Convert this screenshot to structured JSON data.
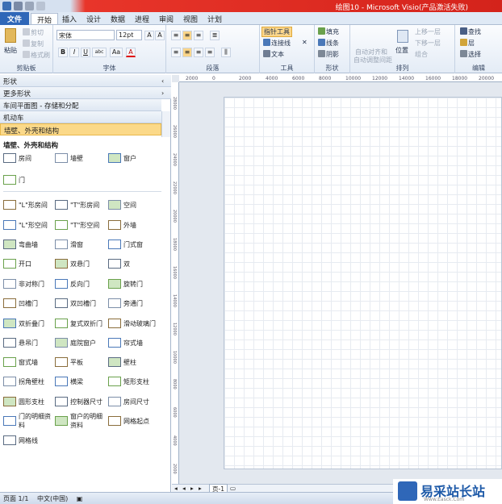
{
  "window": {
    "title": "绘图10 - Microsoft Visio(产品激活失败)"
  },
  "tabs": [
    "文件",
    "开始",
    "插入",
    "设计",
    "数据",
    "进程",
    "审阅",
    "视图",
    "计划"
  ],
  "ribbon": {
    "clipboard": {
      "label": "剪贴板",
      "paste": "粘贴",
      "cut": "剪切",
      "copy": "复制",
      "format_painter": "格式刷"
    },
    "font": {
      "label": "字体",
      "font_name": "宋体",
      "font_size": "12pt",
      "bold": "B",
      "italic": "I",
      "underline": "U",
      "strike": "abc",
      "aa": "Aa",
      "color": "A"
    },
    "paragraph": {
      "label": "段落"
    },
    "tools": {
      "label": "工具",
      "pointer": "指针工具",
      "connector": "连接线",
      "text": "文本"
    },
    "shape": {
      "label": "形状",
      "fill": "填充",
      "line": "线条",
      "shadow": "阴影"
    },
    "arrange": {
      "label": "排列",
      "auto_align": "自动对齐和",
      "auto_space": "自动调整间距",
      "position": "位置",
      "bring_forward": "上移一层",
      "send_backward": "下移一层",
      "group": "组合"
    },
    "edit": {
      "label": "编辑",
      "find": "查找",
      "layer": "层",
      "select": "选择"
    }
  },
  "shapes_panel": {
    "headers": [
      "形状",
      "更多形状",
      "车间平面图 - 存储和分配",
      "机动车",
      "墙壁、外壳和结构"
    ],
    "stencil_title": "墙壁、外壳和结构",
    "items": [
      "房间",
      "墙壁",
      "窗户",
      "门",
      "\"L\"形房间",
      "\"T\"形房间",
      "空间",
      "\"L\"形空间",
      "\"T\"形空间",
      "外墙",
      "弯曲墙",
      "滑窗",
      "门式窗",
      "开口",
      "双悬门",
      "双",
      "非对称门",
      "反向门",
      "旋转门",
      "凹槽门",
      "双凹槽门",
      "旁通门",
      "双折叠门",
      "复式双折门",
      "滑动玻璃门",
      "悬吊门",
      "庭院窗户",
      "帘式墙",
      "窗式墙",
      "平板",
      "壁柱",
      "拐角壁柱",
      "横梁",
      "矩形支柱",
      "圆形支柱",
      "控制器尺寸",
      "房间尺寸",
      "门的明细资料",
      "窗户的明细资料",
      "网格起点",
      "网格线"
    ]
  },
  "ruler": {
    "top_ticks": [
      "2000",
      "0",
      "2000",
      "4000",
      "6000",
      "8000",
      "10000",
      "12000",
      "14000",
      "16000",
      "18000",
      "20000"
    ],
    "left_ticks": [
      "28000",
      "26000",
      "24000",
      "22000",
      "20000",
      "18000",
      "16000",
      "14000",
      "12000",
      "10000",
      "8000",
      "6000",
      "4000",
      "2000"
    ]
  },
  "page_tabs": {
    "page1": "页-1"
  },
  "status": {
    "page": "页面 1/1",
    "lang": "中文(中国)"
  },
  "watermark": {
    "name": "易采站长站",
    "url": "Www.Easck.Com"
  },
  "colors": {
    "accent": "#2f67b8",
    "title_red": "#d4231b"
  }
}
